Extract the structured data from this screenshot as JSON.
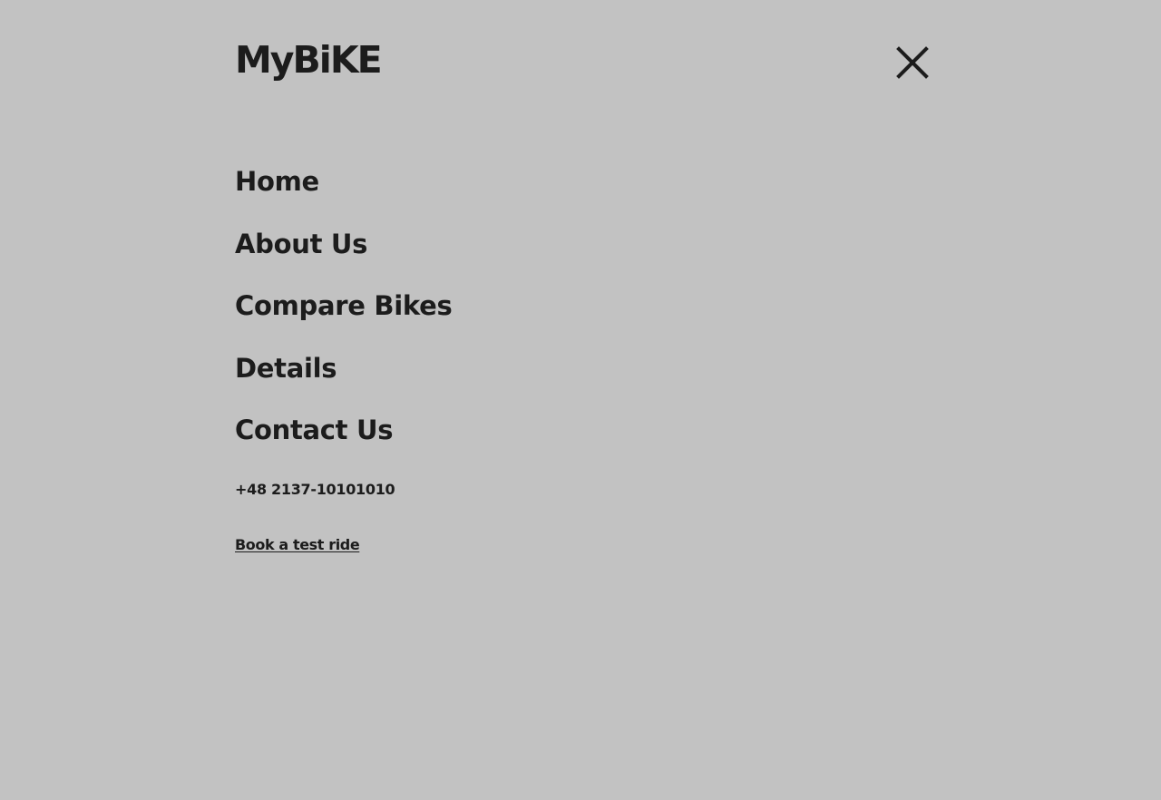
{
  "header": {
    "logo_text": "MyBiKE",
    "close_icon": "close-icon"
  },
  "nav": {
    "items": [
      {
        "label": "Home"
      },
      {
        "label": "About Us"
      },
      {
        "label": "Compare Bikes"
      },
      {
        "label": "Details"
      },
      {
        "label": "Contact Us"
      }
    ]
  },
  "contact": {
    "phone": "+48 2137-10101010",
    "test_ride_label": "Book a test ride"
  },
  "colors": {
    "background": "#c2c2c2",
    "text": "#1c1c1c"
  }
}
